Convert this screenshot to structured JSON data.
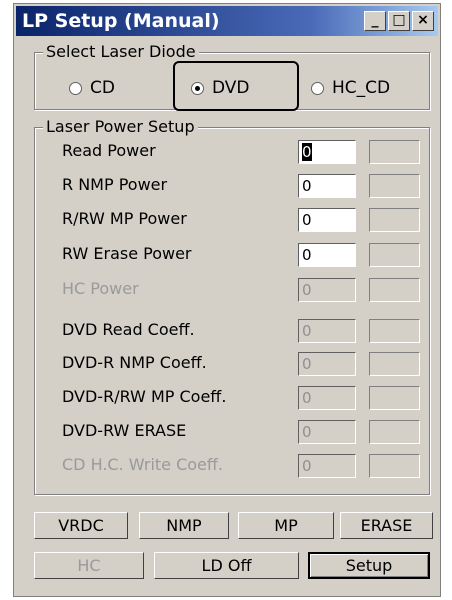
{
  "window": {
    "title": "LP Setup (Manual)"
  },
  "titlebar_buttons": [
    {
      "name": "minimize",
      "glyph": "_"
    },
    {
      "name": "maximize",
      "glyph": "□"
    },
    {
      "name": "close",
      "glyph": "×"
    }
  ],
  "laser_diode": {
    "legend": "Select Laser Diode",
    "options": [
      {
        "label": "CD",
        "selected": false
      },
      {
        "label": "DVD",
        "selected": true
      },
      {
        "label": "HC_CD",
        "selected": false
      }
    ]
  },
  "power_setup": {
    "legend": "Laser Power Setup",
    "rows": [
      {
        "label": "Read Power",
        "value": "0",
        "enabled": true
      },
      {
        "label": "R NMP Power",
        "value": "0",
        "enabled": true
      },
      {
        "label": "R/RW MP Power",
        "value": "0",
        "enabled": true
      },
      {
        "label": "RW Erase Power",
        "value": "0",
        "enabled": true
      },
      {
        "label": "HC Power",
        "value": "0",
        "enabled": false
      },
      {
        "label": "DVD Read Coeff.",
        "value": "0",
        "enabled": true
      },
      {
        "label": "DVD-R NMP Coeff.",
        "value": "0",
        "enabled": true
      },
      {
        "label": "DVD-R/RW MP Coeff.",
        "value": "0",
        "enabled": true
      },
      {
        "label": "DVD-RW ERASE",
        "value": "0",
        "enabled": true
      },
      {
        "label": "CD H.C. Write Coeff.",
        "value": "0",
        "enabled": false
      }
    ]
  },
  "buttons_row1": [
    {
      "label": "VRDC",
      "enabled": true
    },
    {
      "label": "NMP",
      "enabled": true
    },
    {
      "label": "MP",
      "enabled": true
    },
    {
      "label": "ERASE",
      "enabled": true
    }
  ],
  "buttons_row2": [
    {
      "label": "HC",
      "enabled": false
    },
    {
      "label": "LD Off",
      "enabled": true
    },
    {
      "label": "Setup",
      "enabled": true,
      "default": true
    }
  ]
}
